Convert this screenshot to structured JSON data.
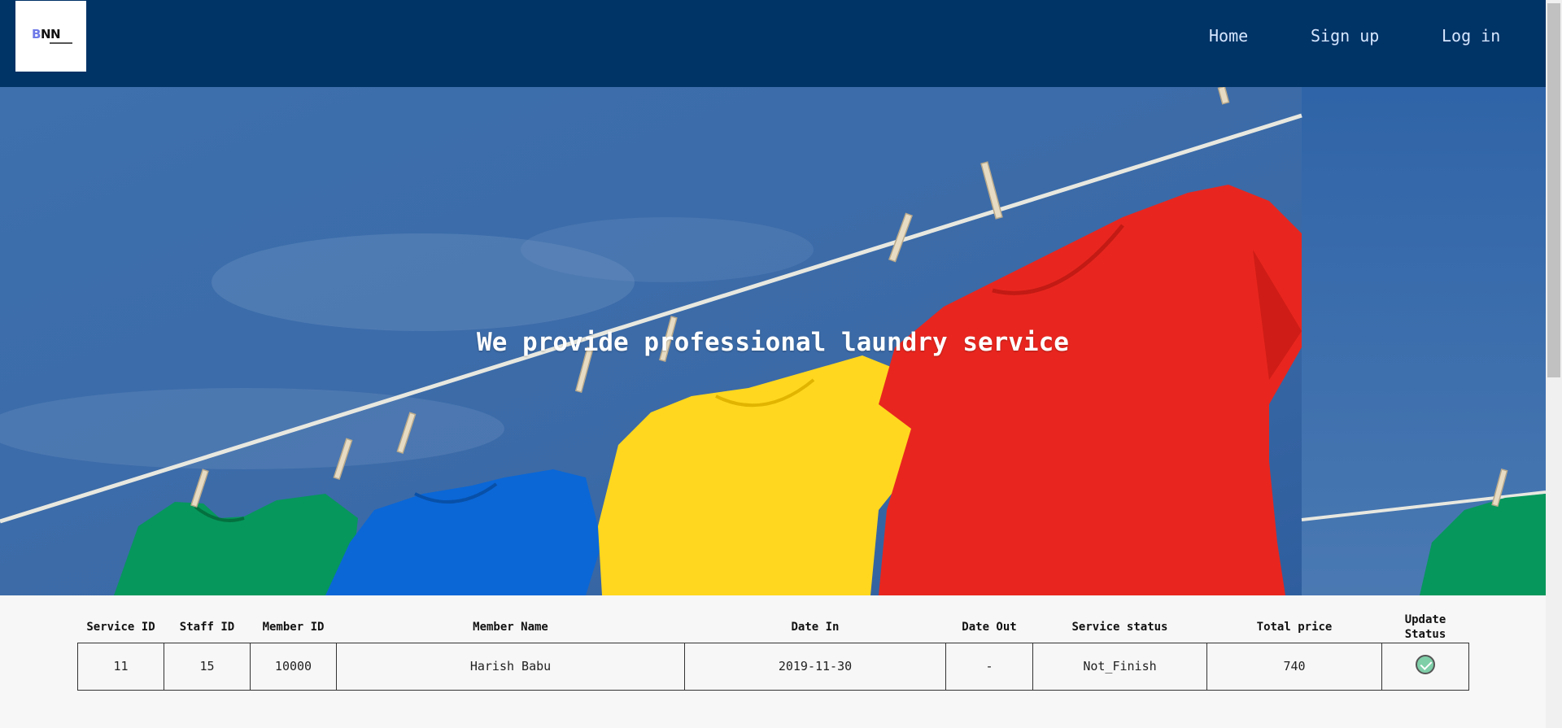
{
  "nav": {
    "logo_text": "BNN",
    "links": [
      "Home",
      "Sign up",
      "Log in"
    ]
  },
  "hero": {
    "title": "We provide professional laundry service"
  },
  "table": {
    "headers": [
      "Service ID",
      "Staff ID",
      "Member ID",
      "Member Name",
      "Date In",
      "Date Out",
      "Service status",
      "Total price",
      "Update Status"
    ],
    "rows": [
      {
        "service_id": "11",
        "staff_id": "15",
        "member_id": "10000",
        "member_name": "Harish Babu",
        "date_in": "2019-11-30",
        "date_out": "-",
        "service_status": "Not_Finish",
        "total_price": "740",
        "update_icon": "check-circle-icon"
      }
    ]
  },
  "colors": {
    "navbar": "#003366",
    "nav_link": "#d6e6ff",
    "sky": "#3a6aa8",
    "shirt_red": "#e8261f",
    "shirt_yellow": "#ffd520",
    "shirt_blue": "#0a67d4",
    "shirt_green": "#059a5c",
    "check": "#7fcfa9"
  }
}
